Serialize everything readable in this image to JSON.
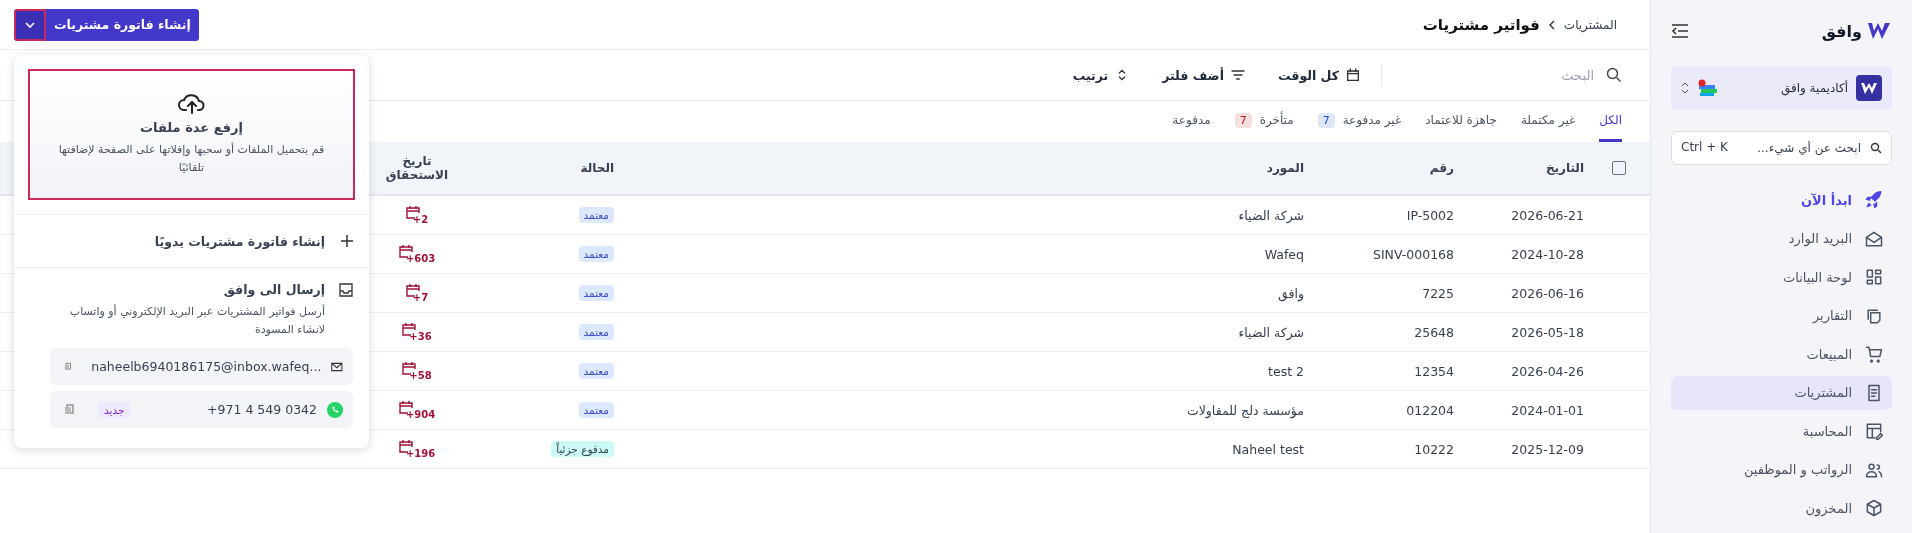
{
  "sidebar": {
    "logo_text": "وافق",
    "org": {
      "name": "أكاديمية وافق",
      "has_alert": true
    },
    "search": {
      "placeholder": "ابحث عن أي شيء...",
      "shortcut": "Ctrl + K"
    },
    "items": [
      {
        "label": "ابدأ الآن",
        "kind": "accent",
        "selected": false
      },
      {
        "label": "البريد الوارد",
        "kind": "plain",
        "selected": false
      },
      {
        "label": "لوحة البيانات",
        "kind": "plain",
        "selected": false
      },
      {
        "label": "التقارير",
        "kind": "plain",
        "selected": false
      },
      {
        "label": "المبيعات",
        "kind": "plain",
        "selected": false
      },
      {
        "label": "المشتريات",
        "kind": "plain",
        "selected": true
      },
      {
        "label": "المحاسبة",
        "kind": "plain",
        "selected": false
      },
      {
        "label": "الرواتب و الموظفين",
        "kind": "plain",
        "selected": false
      },
      {
        "label": "المخزون",
        "kind": "plain",
        "selected": false
      }
    ]
  },
  "breadcrumb": {
    "parent": "المشتريات",
    "current": "فواتير مشتريات"
  },
  "create_button": {
    "label": "إنشاء فاتورة مشتريات",
    "menu_open": true,
    "caret_highlighted": true
  },
  "create_menu": {
    "upload": {
      "title": "إرفع عدة ملفات",
      "description": "قم بتحميل الملفات أو سحبها وإفلاتها على الصفحة لإضافتها تلقائيًا",
      "highlighted": true
    },
    "manual": {
      "label": "إنشاء فاتورة مشتريات يدويًا"
    },
    "send": {
      "title": "إرسال الى وافق",
      "description": "أرسل فواتير المشتريات عبر البريد الإلكتروني أو واتساب لانشاء المسودة",
      "email": "naheelb6940186175@inbox.wafeq...",
      "phone": "+971 4 549 0342",
      "phone_badge": "جديد"
    }
  },
  "toolbar": {
    "search": {
      "placeholder": "البحث"
    },
    "buttons": [
      {
        "label": "كل الوقت",
        "kind": "date"
      },
      {
        "label": "أضف فلتر",
        "kind": "filter"
      },
      {
        "label": "ترتيب",
        "kind": "sort"
      }
    ]
  },
  "tabs": [
    {
      "label": "الكل",
      "selected": true
    },
    {
      "label": "غير مكتملة",
      "selected": false
    },
    {
      "label": "جاهزة للاعتماد",
      "selected": false
    },
    {
      "label": "غير مدفوعة",
      "count": "7",
      "color": "#1d4ed8",
      "selected": false
    },
    {
      "label": "متأخرة",
      "count": "7",
      "color": "#b91c1c",
      "selected": false
    },
    {
      "label": "مدفوعة",
      "selected": false
    }
  ],
  "table": {
    "select_all": {
      "checked": false
    },
    "columns": [
      "التاريخ",
      "رقم",
      "المورد",
      "الحالة",
      "تاريخ الاستحقاق"
    ],
    "rows": [
      {
        "date": "2026-06-21",
        "number": "IP-5002",
        "supplier": "شركة الضياء",
        "status": {
          "label": "معتمد",
          "kind": "approved"
        },
        "due": "+2"
      },
      {
        "date": "2024-10-28",
        "number": "SINV-000168",
        "supplier": "Wafeq",
        "status": {
          "label": "معتمد",
          "kind": "approved"
        },
        "due": "+603"
      },
      {
        "date": "2026-06-16",
        "number": "7225",
        "supplier": "وافق",
        "status": {
          "label": "معتمد",
          "kind": "approved"
        },
        "due": "+7"
      },
      {
        "date": "2026-05-18",
        "number": "25648",
        "supplier": "شركة الضياء",
        "status": {
          "label": "معتمد",
          "kind": "approved"
        },
        "due": "+36"
      },
      {
        "date": "2026-04-26",
        "number": "12354",
        "supplier": "test 2",
        "status": {
          "label": "معتمد",
          "kind": "approved"
        },
        "due": "+58"
      },
      {
        "date": "2024-01-01",
        "number": "012204",
        "supplier": "مؤسسة دلج للمقاولات",
        "status": {
          "label": "معتمد",
          "kind": "approved"
        },
        "due": "+904"
      },
      {
        "date": "2025-12-09",
        "number": "10222",
        "supplier": "Naheel test",
        "status": {
          "label": "مدفوع جزئياً",
          "kind": "partial"
        },
        "due": "+196"
      }
    ]
  }
}
